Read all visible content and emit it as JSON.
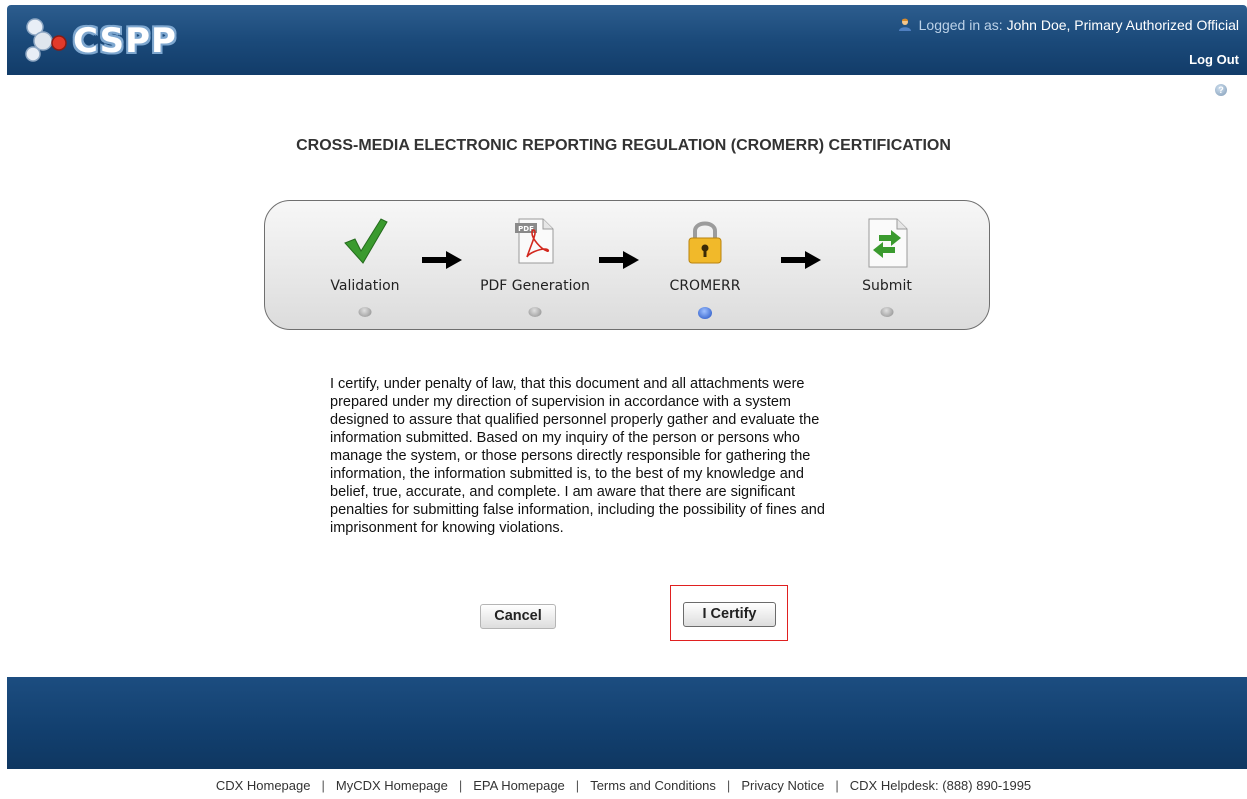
{
  "header": {
    "logo_text": "CSPP",
    "logged_in_label": "Logged in as:",
    "user_name": "John Doe, Primary Authorized Official",
    "logout_label": "Log Out"
  },
  "page": {
    "title": "CROSS-MEDIA ELECTRONIC REPORTING REGULATION (CROMERR) CERTIFICATION"
  },
  "wizard": {
    "steps": [
      {
        "label": "Validation",
        "icon": "checkmark-icon",
        "active": false
      },
      {
        "label": "PDF Generation",
        "icon": "pdf-icon",
        "active": false
      },
      {
        "label": "CROMERR",
        "icon": "lock-icon",
        "active": true
      },
      {
        "label": "Submit",
        "icon": "submit-document-icon",
        "active": false
      }
    ]
  },
  "certification": {
    "lines": [
      "I certify, under penalty of law, that this document and all attachments were",
      "prepared under my direction of supervision in accordance with a system",
      "designed to assure that qualified personnel properly gather and evaluate the",
      "information submitted. Based on my inquiry of the person or persons who",
      "manage the system, or those persons directly responsible for gathering the",
      "information, the information submitted is, to the best of my knowledge and",
      "belief, true, accurate, and complete. I am aware that there are significant",
      "penalties for submitting false information, including the possibility of fines and",
      "imprisonment for knowing violations."
    ]
  },
  "buttons": {
    "cancel": "Cancel",
    "certify": "I Certify"
  },
  "footer": {
    "links": [
      "CDX Homepage",
      "MyCDX Homepage",
      "EPA Homepage",
      "Terms and Conditions",
      "Privacy Notice",
      "CDX Helpdesk: (888) 890-1995"
    ]
  },
  "colors": {
    "header_blue": "#1b4a7a",
    "highlight_red": "#e02020",
    "active_dot_blue": "#1f4fc2",
    "check_green": "#3a9a2e"
  }
}
